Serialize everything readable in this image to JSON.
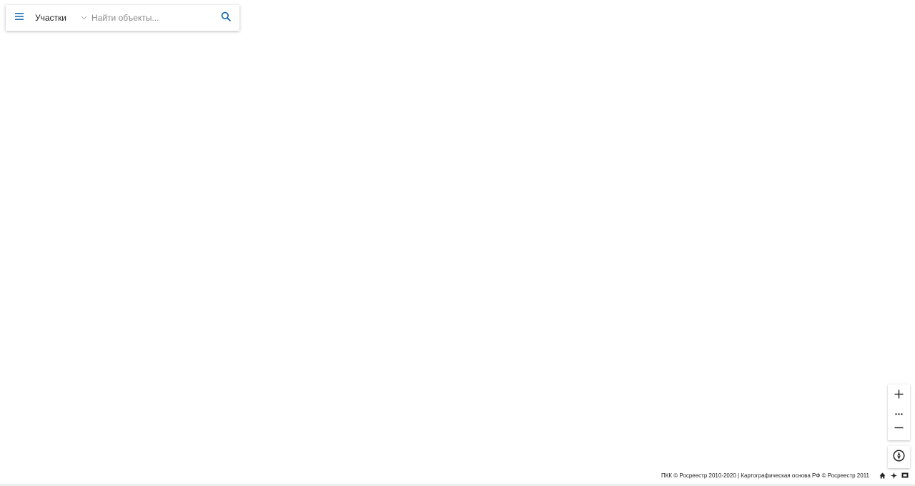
{
  "search_panel": {
    "menu_icon": "hamburger-menu-icon",
    "layer_label": "Участки",
    "layer_chevron_icon": "chevron-down-icon",
    "search_placeholder": "Найти объекты...",
    "search_value": "",
    "search_icon": "search-icon"
  },
  "map_controls": {
    "zoom_in_icon": "plus-icon",
    "zoom_more_icon": "more-dots-icon",
    "zoom_out_icon": "minus-icon",
    "compass_icon": "compass-icon"
  },
  "attribution": {
    "text": "ПКК © Росреестр 2010-2020 | Картографическая основа РФ © Росреестр 2011",
    "icons": [
      "home-icon",
      "locate-icon",
      "map-layers-icon"
    ]
  },
  "colors": {
    "accent": "#1a6fb8",
    "text": "#222222",
    "placeholder": "#8a8a8a"
  }
}
